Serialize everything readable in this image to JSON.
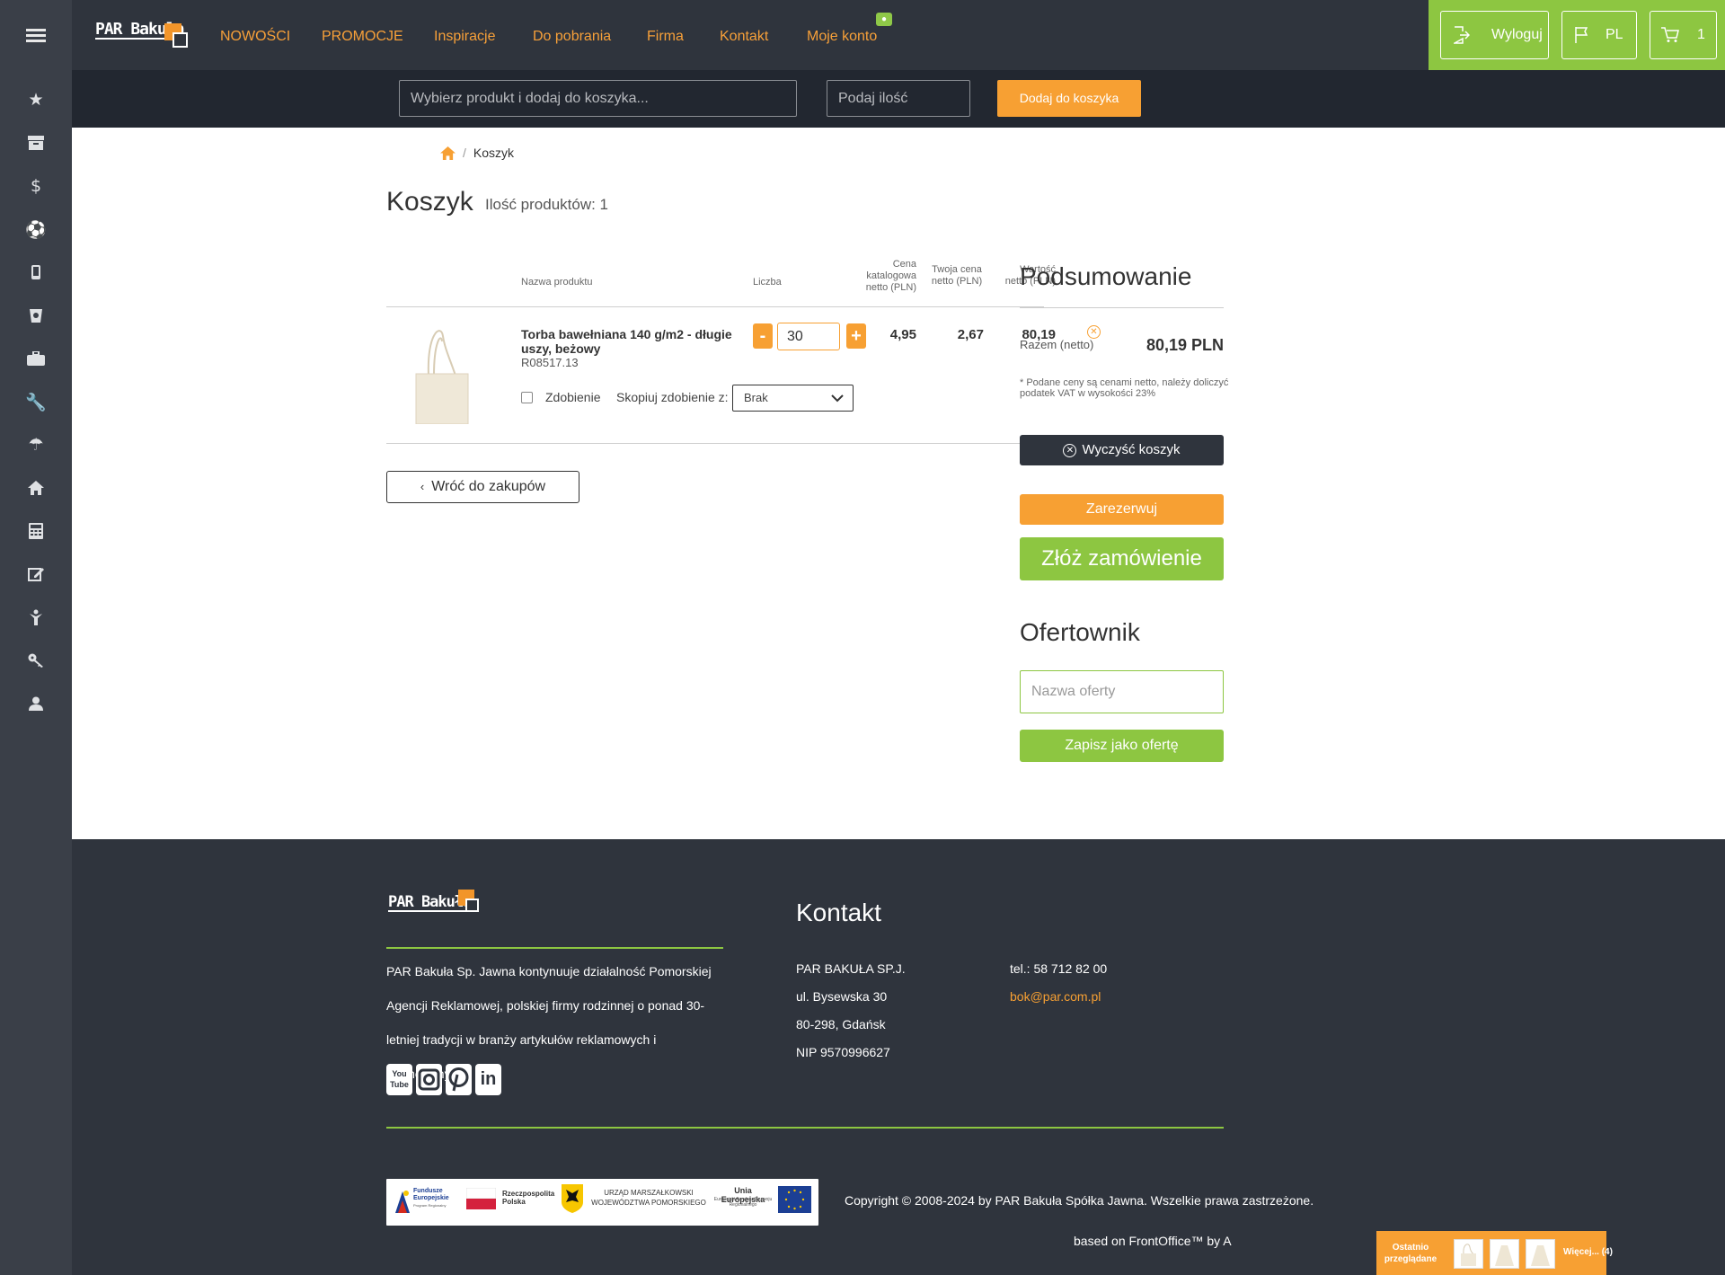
{
  "nav": {
    "logo_text": "PAR Bakuła",
    "links": [
      "NOWOŚCI",
      "PROMOCJE",
      "Inspiracje",
      "Do pobrania",
      "Firma",
      "Kontakt",
      "Moje konto"
    ]
  },
  "top_right": {
    "logout_label": "Wyloguj",
    "lang_label": "PL",
    "cart_count": "1"
  },
  "quickbar": {
    "product_placeholder": "Wybierz produkt i dodaj do koszyka...",
    "qty_placeholder": "Podaj ilość",
    "add_label": "Dodaj do koszyka"
  },
  "breadcrumb": {
    "current": "Koszyk"
  },
  "cart": {
    "title": "Koszyk",
    "count_label": "Ilość produktów: 1",
    "columns": {
      "name": "Nazwa produktu",
      "qty": "Liczba",
      "catalog_price": "Cena katalogowa netto (PLN)",
      "your_price": "Twoja cena netto (PLN)",
      "value": "Wartość netto (PLN)"
    },
    "item": {
      "name": "Torba bawełniana 140 g/m2 - długie uszy, beżowy",
      "sku": "R08517.13",
      "qty": "30",
      "minus": "-",
      "plus": "+",
      "catalog_price": "4,95",
      "your_price": "2,67",
      "value": "80,19",
      "decoration_label": "Zdobienie",
      "copy_label": "Skopiuj zdobienie z:",
      "copy_value": "Brak"
    },
    "back_label": "Wróć do zakupów"
  },
  "summary": {
    "title": "Podsumowanie",
    "total_label": "Razem (netto)",
    "total_value": "80,19 PLN",
    "vat_note": "* Podane ceny są cenami netto, należy doliczyć podatek VAT w wysokości 23%",
    "clear_label": "Wyczyść koszyk",
    "reserve_label": "Zarezerwuj",
    "order_label": "Złóż zamówienie"
  },
  "offer": {
    "title": "Ofertownik",
    "name_placeholder": "Nazwa oferty",
    "save_label": "Zapisz jako ofertę"
  },
  "footer": {
    "logo_text": "PAR Bakuła",
    "about": "PAR Bakuła Sp. Jawna kontynuuje działalność Pomorskiej Agencji Reklamowej, polskiej firmy rodzinnej o ponad 30-letniej tradycji w branży artykułów reklamowych i promocyjnych.",
    "social": [
      "You Tube",
      "Instagram",
      "Pinterest",
      "LinkedIn"
    ],
    "contact_title": "Kontakt",
    "company": "PAR BAKUŁA SP.J.",
    "street": "ul. Bysewska 30",
    "city": "80-298, Gdańsk",
    "nip": "NIP 9570996627",
    "phone": "tel.: 58 712 82 00",
    "email": "bok@par.com.pl",
    "eu": {
      "funds": "Fundusze Europejskie",
      "funds_sub": "Program Regionalny",
      "poland": "Rzeczpospolita Polska",
      "marshal": "URZĄD MARSZAŁKOWSKI WOJEWÓDZTWA POMORSKIEGO",
      "union": "Unia Europejska",
      "union_sub": "Europejski Fundusz Rozwoju Regionalnego"
    },
    "copyright": "Copyright © 2008-2024 by PAR Bakuła Spółka Jawna. Wszelkie prawa zastrzeżone.",
    "based_on": "based on FrontOffice™ by A"
  },
  "recent": {
    "label": "Ostatnio przeglądane",
    "more": "Więcej... (4)"
  },
  "colors": {
    "accent_orange": "#f7a033",
    "accent_green": "#8dc641",
    "dark": "#2f343d"
  }
}
